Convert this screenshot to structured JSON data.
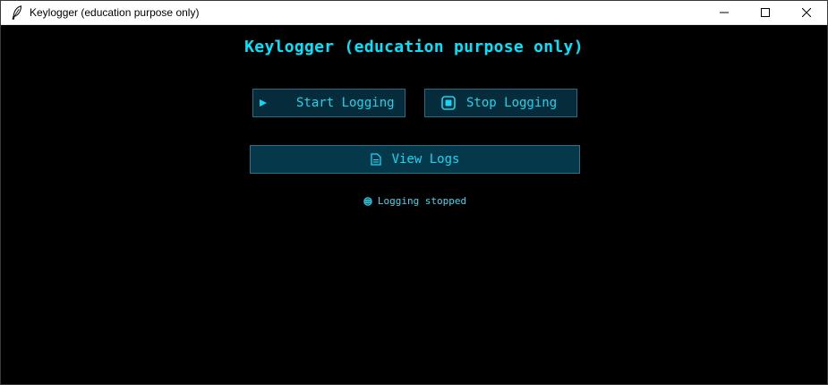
{
  "window": {
    "title": "Keylogger (education purpose only)",
    "app_icon": "feather-icon"
  },
  "header": {
    "title": "Keylogger (education purpose only)"
  },
  "controls": {
    "start_label": "Start Logging",
    "start_icon": "play-icon",
    "stop_label": "Stop Logging",
    "stop_icon": "stop-icon",
    "view_label": "View Logs",
    "view_icon": "document-icon"
  },
  "status": {
    "text": "Logging stopped",
    "icon": "status-dot-icon"
  },
  "colors": {
    "background": "#000000",
    "accent": "#00e5ff",
    "button_bg": "#062b3a",
    "button_border": "#2c6a80"
  }
}
